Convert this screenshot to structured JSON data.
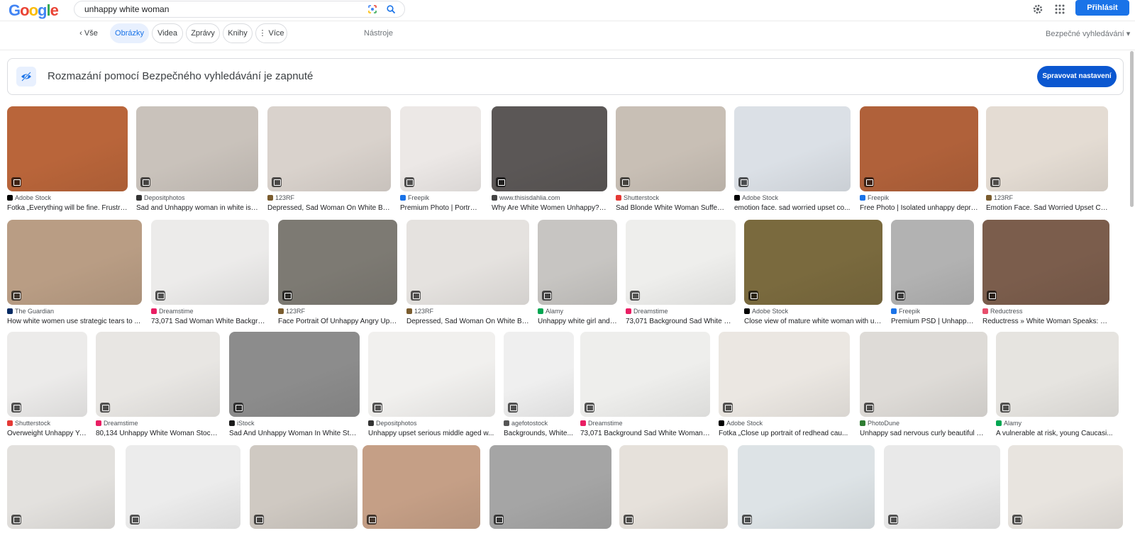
{
  "header": {
    "logo_letters": [
      "G",
      "o",
      "o",
      "g",
      "l",
      "e"
    ],
    "search_value": "unhappy white woman",
    "signin_label": "Přihlásit"
  },
  "tabs": {
    "items": [
      "Vše",
      "Obrázky",
      "Videa",
      "Zprávy",
      "Knihy",
      "Více"
    ],
    "tools": "Nástroje",
    "safe_search": "Bezpečné vyhledávání"
  },
  "banner": {
    "text": "Rozmazání pomocí Bezpečného vyhledávání je zapnuté",
    "button": "Spravovat nastavení"
  },
  "rows": [
    [
      {
        "source": "Adobe Stock",
        "caption": "Fotka „Everything will be fine. Frustra...",
        "color": "#b9653a",
        "src_color": "#000000"
      },
      {
        "source": "Depositphotos",
        "caption": "Sad and Unhappy woman in white is c...",
        "color": "#c9c2bb",
        "src_color": "#333333"
      },
      {
        "source": "123RF",
        "caption": "Depressed, Sad Woman On White Bac...",
        "color": "#d9d2cc",
        "src_color": "#7a5c2e"
      },
      {
        "source": "Freepik",
        "caption": "Premium Photo | Portrai...",
        "color": "#ece8e6",
        "src_color": "#1a73e8"
      },
      {
        "source": "www.thisisdahlia.com",
        "caption": "Why Are White Women Unhappy? - ...",
        "color": "#5b5756",
        "src_color": "#444444"
      },
      {
        "source": "Shutterstock",
        "caption": "Sad Blonde White Woman Sufferi...",
        "color": "#c8bfb5",
        "src_color": "#e53935"
      },
      {
        "source": "Adobe Stock",
        "caption": "emotion face. sad worried upset co...",
        "color": "#dbe0e6",
        "src_color": "#000000"
      },
      {
        "source": "Freepik",
        "caption": "Free Photo | Isolated unhappy depre...",
        "color": "#b0613a",
        "src_color": "#1a73e8"
      },
      {
        "source": "123RF",
        "caption": "Emotion Face. Sad Worried Upset Co...",
        "color": "#e4dcd3",
        "src_color": "#7a5c2e"
      }
    ],
    [
      {
        "source": "The Guardian",
        "caption": "How white women use strategic tears to ...",
        "color": "#b99d84",
        "src_color": "#052962"
      },
      {
        "source": "Dreamstime",
        "caption": "73,071 Sad Woman White Backgrou...",
        "color": "#ecebea",
        "src_color": "#e91e63"
      },
      {
        "source": "123RF",
        "caption": "Face Portrait Of Unhappy Angry Ups...",
        "color": "#7d7a73",
        "src_color": "#7a5c2e"
      },
      {
        "source": "123RF",
        "caption": "Depressed, Sad Woman On White Bac...",
        "color": "#e5e2df",
        "src_color": "#7a5c2e"
      },
      {
        "source": "Alamy",
        "caption": "Unhappy white girl and ...",
        "color": "#c7c5c2",
        "src_color": "#00a651"
      },
      {
        "source": "Dreamstime",
        "caption": "73,071 Background Sad White W...",
        "color": "#eeeeec",
        "src_color": "#e91e63"
      },
      {
        "source": "Adobe Stock",
        "caption": "Close view of mature white woman with un...",
        "color": "#7a6a3e",
        "src_color": "#000000"
      },
      {
        "source": "Freepik",
        "caption": "Premium PSD | Unhappy...",
        "color": "#b2b2b2",
        "src_color": "#1a73e8"
      },
      {
        "source": "Reductress",
        "caption": "Reductress » White Woman Speaks: \"T...",
        "color": "#7b5d4c",
        "src_color": "#e84e6c"
      }
    ],
    [
      {
        "source": "Shutterstock",
        "caption": "Overweight Unhappy Yo...",
        "color": "#ecebea",
        "src_color": "#e53935"
      },
      {
        "source": "Dreamstime",
        "caption": "80,134 Unhappy White Woman Stock ...",
        "color": "#e8e6e3",
        "src_color": "#e91e63"
      },
      {
        "source": "iStock",
        "caption": "Sad And Unhappy Woman In White Stoc...",
        "color": "#8c8c8c",
        "src_color": "#1a1a1a"
      },
      {
        "source": "Depositphotos",
        "caption": "Unhappy upset serious middle aged w...",
        "color": "#f1f0ee",
        "src_color": "#333333"
      },
      {
        "source": "agefotostock",
        "caption": "Backgrounds, White...",
        "color": "#efefef",
        "src_color": "#555555"
      },
      {
        "source": "Dreamstime",
        "caption": "73,071 Background Sad White Woman S...",
        "color": "#eeeeec",
        "src_color": "#e91e63"
      },
      {
        "source": "Adobe Stock",
        "caption": "Fotka „Close up portrait of redhead cau...",
        "color": "#ebe7e2",
        "src_color": "#000000"
      },
      {
        "source": "PhotoDune",
        "caption": "Unhappy sad nervous curly beautiful wo...",
        "color": "#dedbd7",
        "src_color": "#2e7d32"
      },
      {
        "source": "Alamy",
        "caption": "A vulnerable at risk, young Caucasi...",
        "color": "#e6e4e0",
        "src_color": "#00a651"
      }
    ],
    [
      {
        "color": "#e3e1de"
      },
      {
        "color": "#ececec"
      },
      {
        "color": "#cfc9c2"
      },
      {
        "color": "#c59f86"
      },
      {
        "color": "#a5a5a5"
      },
      {
        "color": "#e6e1db"
      },
      {
        "color": "#dde3e6"
      },
      {
        "color": "#e9e9e9"
      },
      {
        "color": "#e8e4df"
      }
    ]
  ]
}
